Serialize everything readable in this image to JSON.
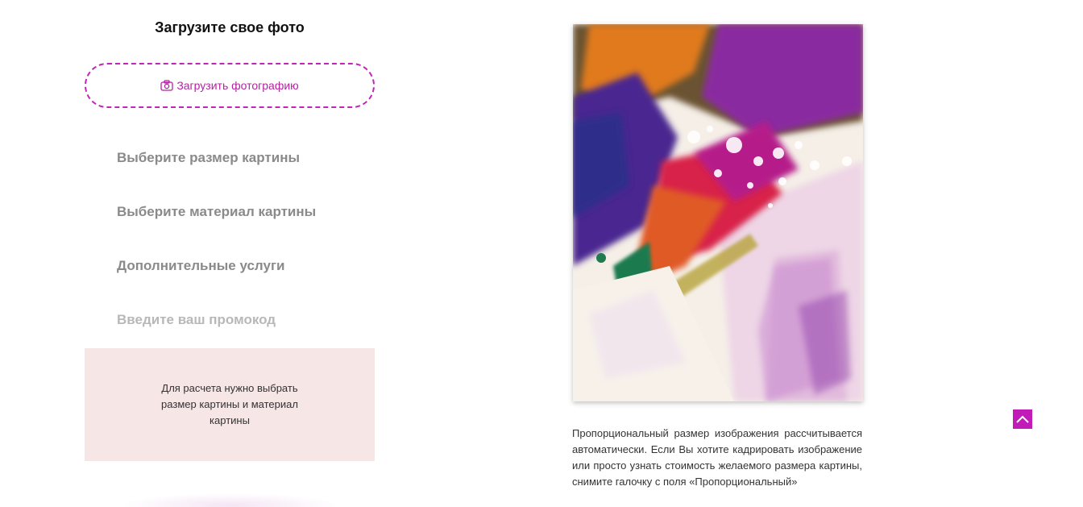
{
  "upload": {
    "title": "Загрузите свое фото",
    "button_label": "Загрузить фотографию",
    "button_icon": "camera-icon"
  },
  "steps": [
    {
      "label": "Выберите размер картины"
    },
    {
      "label": "Выберите материал картины"
    },
    {
      "label": "Дополнительные услуги"
    },
    {
      "label": "Введите ваш промокод"
    }
  ],
  "calc": {
    "message": "Для расчета нужно выбрать размер картины и материал картины"
  },
  "preview": {
    "note": "Пропорциональный размер изображения рассчитывается автоматически. Если Вы хотите кадрировать изображение или просто узнать стоимость желаемого размера картины, снимите галочку с поля «Пропорциональный»"
  },
  "scroll_top": {
    "icon": "chevron-up-icon"
  },
  "colors": {
    "accent": "#c21cb8",
    "calc_bg": "#f6e6e6",
    "step_text": "#8a8a8a"
  }
}
